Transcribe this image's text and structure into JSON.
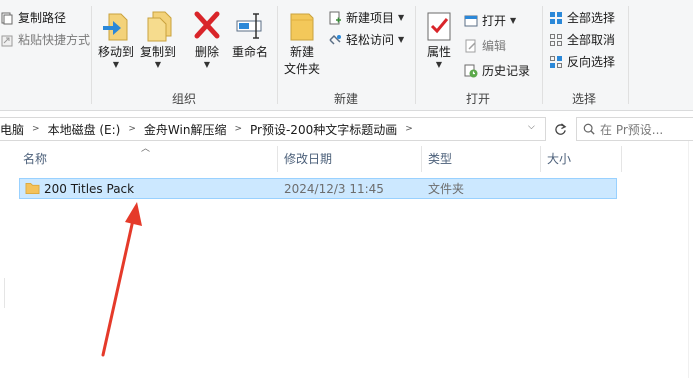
{
  "ribbon": {
    "clipboard": {
      "copy_path": "复制路径",
      "paste_shortcut": "粘贴快捷方式"
    },
    "organize": {
      "move_to": "移动到",
      "copy_to": "复制到",
      "delete": "删除",
      "rename": "重命名",
      "group_label": "组织"
    },
    "new": {
      "new_folder_line1": "新建",
      "new_folder_line2": "文件夹",
      "new_item": "新建项目",
      "easy_access": "轻松访问",
      "group_label": "新建"
    },
    "open": {
      "properties": "属性",
      "open": "打开",
      "edit": "编辑",
      "history": "历史记录",
      "group_label": "打开"
    },
    "select": {
      "select_all": "全部选择",
      "select_none": "全部取消",
      "invert": "反向选择",
      "group_label": "选择"
    }
  },
  "address": {
    "crumbs": [
      "电脑",
      "本地磁盘 (E:)",
      "金舟Win解压缩",
      "Pr预设-200种文字标题动画"
    ],
    "search_placeholder": "在 Pr预设..."
  },
  "columns": {
    "name": "名称",
    "modified": "修改日期",
    "type": "类型",
    "size": "大小"
  },
  "files": [
    {
      "name": "200 Titles Pack",
      "modified": "2024/12/3 11:45",
      "type": "文件夹",
      "size": "",
      "selected": true
    }
  ],
  "colors": {
    "selection_bg": "#cce8ff",
    "selection_border": "#99d1ff",
    "annotation_arrow": "#e53a2a",
    "delete_red": "#d9252a",
    "folder": "#f4c25b"
  }
}
